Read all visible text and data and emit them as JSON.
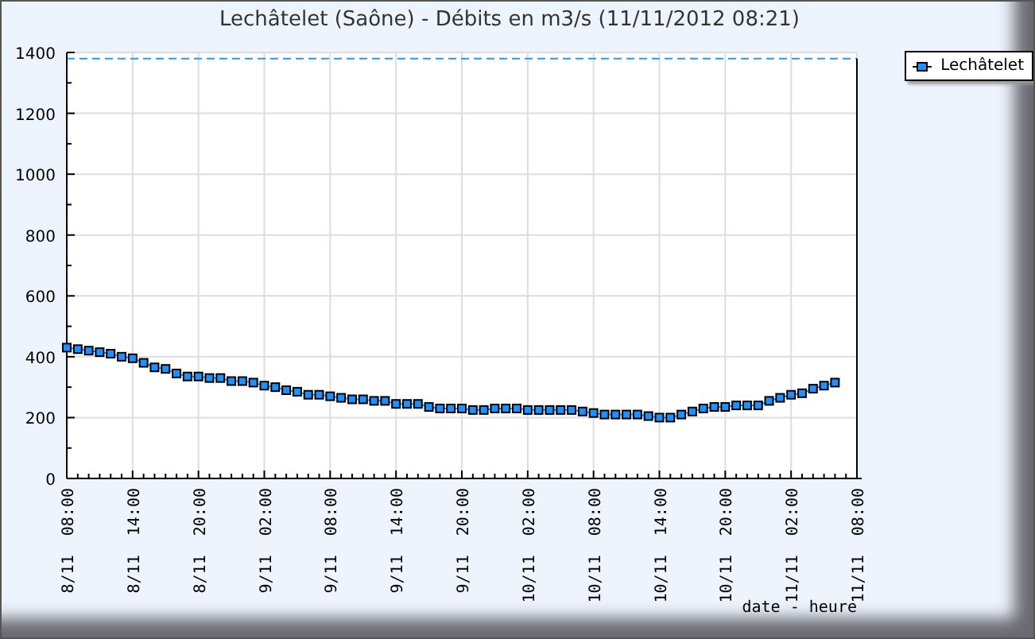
{
  "title": "Lechâtelet (Saône) - Débits en m3/s (11/11/2012 08:21)",
  "chart_data": {
    "type": "line",
    "xlabel": "date - heure",
    "ylim": [
      0,
      1400
    ],
    "grid": true,
    "yticks": [
      0,
      200,
      400,
      600,
      800,
      1000,
      1200,
      1400
    ],
    "ref_lines": [
      {
        "axis": "y",
        "value": 1380,
        "color": "#1e9fff"
      }
    ],
    "categories": [
      "8/11  08:00",
      null,
      null,
      null,
      null,
      null,
      "8/11  14:00",
      null,
      null,
      null,
      null,
      null,
      "8/11  20:00",
      null,
      null,
      null,
      null,
      null,
      "9/11  02:00",
      null,
      null,
      null,
      null,
      null,
      "9/11  08:00",
      null,
      null,
      null,
      null,
      null,
      "9/11  14:00",
      null,
      null,
      null,
      null,
      null,
      "9/11  20:00",
      null,
      null,
      null,
      null,
      null,
      "10/11  02:00",
      null,
      null,
      null,
      null,
      null,
      "10/11  08:00",
      null,
      null,
      null,
      null,
      null,
      "10/11  14:00",
      null,
      null,
      null,
      null,
      null,
      "10/11  20:00",
      null,
      null,
      null,
      null,
      null,
      "11/11  02:00",
      null,
      null,
      null,
      null,
      null,
      "11/11  08:00"
    ],
    "series": [
      {
        "name": "Lechâtelet",
        "color": "#1e90ff",
        "marker": "square",
        "values": [
          430,
          425,
          420,
          415,
          410,
          400,
          395,
          380,
          365,
          360,
          345,
          335,
          335,
          330,
          330,
          320,
          320,
          315,
          305,
          300,
          290,
          285,
          275,
          275,
          270,
          265,
          260,
          260,
          255,
          255,
          245,
          245,
          245,
          235,
          230,
          230,
          230,
          225,
          225,
          230,
          230,
          230,
          225,
          225,
          225,
          225,
          225,
          220,
          215,
          210,
          210,
          210,
          210,
          205,
          200,
          200,
          210,
          220,
          230,
          235,
          235,
          240,
          240,
          240,
          255,
          265,
          275,
          280,
          295,
          305,
          315,
          null,
          null
        ]
      }
    ]
  }
}
